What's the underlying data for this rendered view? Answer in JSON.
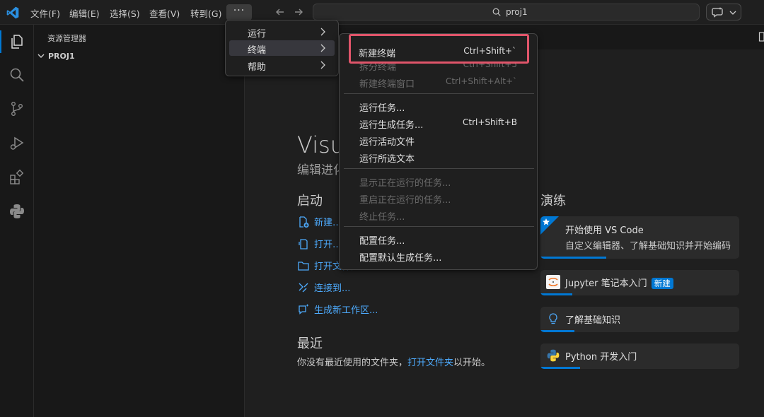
{
  "titlebar": {
    "menus": [
      "文件(F)",
      "编辑(E)",
      "选择(S)",
      "查看(V)",
      "转到(G)"
    ],
    "more_label": "···",
    "search_text": "proj1"
  },
  "sidebar": {
    "title": "资源管理器",
    "project": "PROJ1"
  },
  "welcome": {
    "title": "Visu",
    "subtitle": "编辑进化",
    "start_heading": "启动",
    "start_links": [
      "新建…",
      "打开…",
      "打开文件夹…",
      "连接到...",
      "生成新工作区..."
    ],
    "recent_heading": "最近",
    "recent_prefix": "你没有最近使用的文件夹，",
    "recent_link": "打开文件夹",
    "recent_suffix": "以开始。",
    "walkthrough_heading": "演练",
    "walkthroughs": [
      {
        "title": "开始使用 VS Code",
        "desc": "自定义编辑器、了解基础知识并开始编码",
        "progress": 0.33
      },
      {
        "title": "Jupyter 笔记本入门",
        "badge": "新建",
        "progress": 0.16
      },
      {
        "title": "了解基础知识",
        "progress": 0.17
      },
      {
        "title": "Python 开发入门",
        "progress": 0.2
      }
    ]
  },
  "more_menu": {
    "items": [
      "运行",
      "终端",
      "帮助"
    ],
    "active_index": 1
  },
  "terminal_menu": {
    "groups": [
      [
        {
          "label": "新建终端",
          "shortcut": "Ctrl+Shift+`",
          "disabled": false,
          "highlighted": true
        },
        {
          "label": "拆分终端",
          "shortcut": "Ctrl+Shift+5",
          "disabled": true
        },
        {
          "label": "新建终端窗口",
          "shortcut": "Ctrl+Shift+Alt+`",
          "disabled": true
        }
      ],
      [
        {
          "label": "运行任务...",
          "shortcut": "",
          "disabled": false
        },
        {
          "label": "运行生成任务...",
          "shortcut": "Ctrl+Shift+B",
          "disabled": false
        },
        {
          "label": "运行活动文件",
          "shortcut": "",
          "disabled": false
        },
        {
          "label": "运行所选文本",
          "shortcut": "",
          "disabled": false
        }
      ],
      [
        {
          "label": "显示正在运行的任务...",
          "shortcut": "",
          "disabled": true
        },
        {
          "label": "重启正在运行的任务...",
          "shortcut": "",
          "disabled": true
        },
        {
          "label": "终止任务...",
          "shortcut": "",
          "disabled": true
        }
      ],
      [
        {
          "label": "配置任务...",
          "shortcut": "",
          "disabled": false
        },
        {
          "label": "配置默认生成任务...",
          "shortcut": "",
          "disabled": false
        }
      ]
    ]
  },
  "colors": {
    "accent": "#0078d4",
    "link": "#4daafc",
    "highlight_border": "#e0556a"
  }
}
